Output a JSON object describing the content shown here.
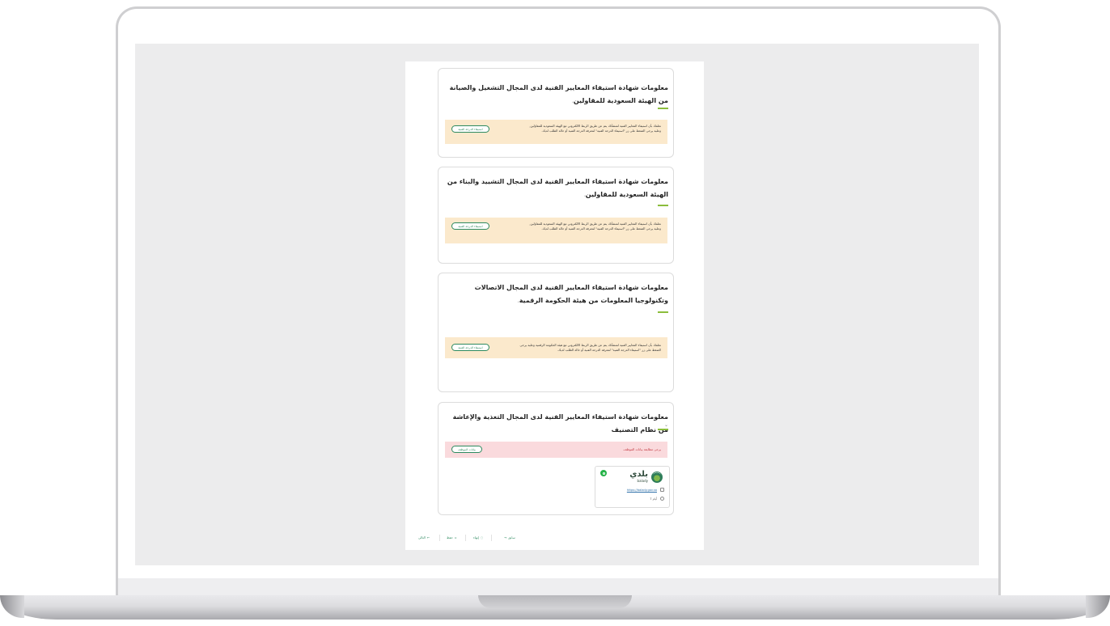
{
  "cards": [
    {
      "title": "معلومات شهادة استيفاء المعايير الفنية لدى المجال التشغيل والصيانة من الهيئة السعودية للمقاولين",
      "notice": "نعلمك بأن استيفاء المعايير الفنية لمنشأتك يتم عن طريق الربط الالكتروني مع الهيئة السعودية للمقاولين, وعليه يرجى الضغط على زر \"استيفاء الدرجة الفنية\" لمعرفة الدرجة الفنية أو حالة الطلب لديك.",
      "button": "استيفاء الدرجة الفنية"
    },
    {
      "title": "معلومات شهادة استيفاء المعايير الفنية لدى المجال التشييد والبناء من الهيئة السعودية للمقاولين",
      "notice": "نعلمك بأن استيفاء المعايير الفنية لمنشأتك يتم عن طريق الربط الالكتروني مع الهيئة السعودية للمقاولين, وعليه يرجى الضغط على زر \"استيفاء الدرجة الفنية\" لمعرفة الدرجة الفنية أو حالة الطلب لديك.",
      "button": "استيفاء الدرجة الفنية"
    },
    {
      "title": "معلومات شهادة استيفاء المعايير الفنية لدى المجال الاتصالات وتكنولوجيا المعلومات من هيئة الحكومة الرقمية",
      "notice": "نعلمك بأن استيفاء المعايير الفنية لمنشأتك يتم عن طريق الربط الالكتروني مع هيئة الحكومة الرقمية وعليه يرجى الضغط على زر \"استيفاء الدرجة الفنية\" لمعرفة الدرجة الفنية أو حالة الطلب لديك.",
      "button": "استيفاء الدرجة الفنية"
    },
    {
      "title": "معلومات شهادة استيفاء المعايير الفنية لدى المجال التغذية والإعاشة من نظام التصنيف",
      "notice": "يرجى مطابقة بيانات الموظف.",
      "button": "بيانات الموظف"
    }
  ],
  "contact": {
    "logo_ar": "بلدي",
    "logo_en": "balady",
    "website": "https://balady.gov.sa",
    "hours": "7 أيام"
  },
  "footer": {
    "prev": "سابق",
    "done": "إنهاء",
    "save": "حفظ",
    "next": "التالي",
    "prev_arrow": "→",
    "next_arrow": "←"
  }
}
